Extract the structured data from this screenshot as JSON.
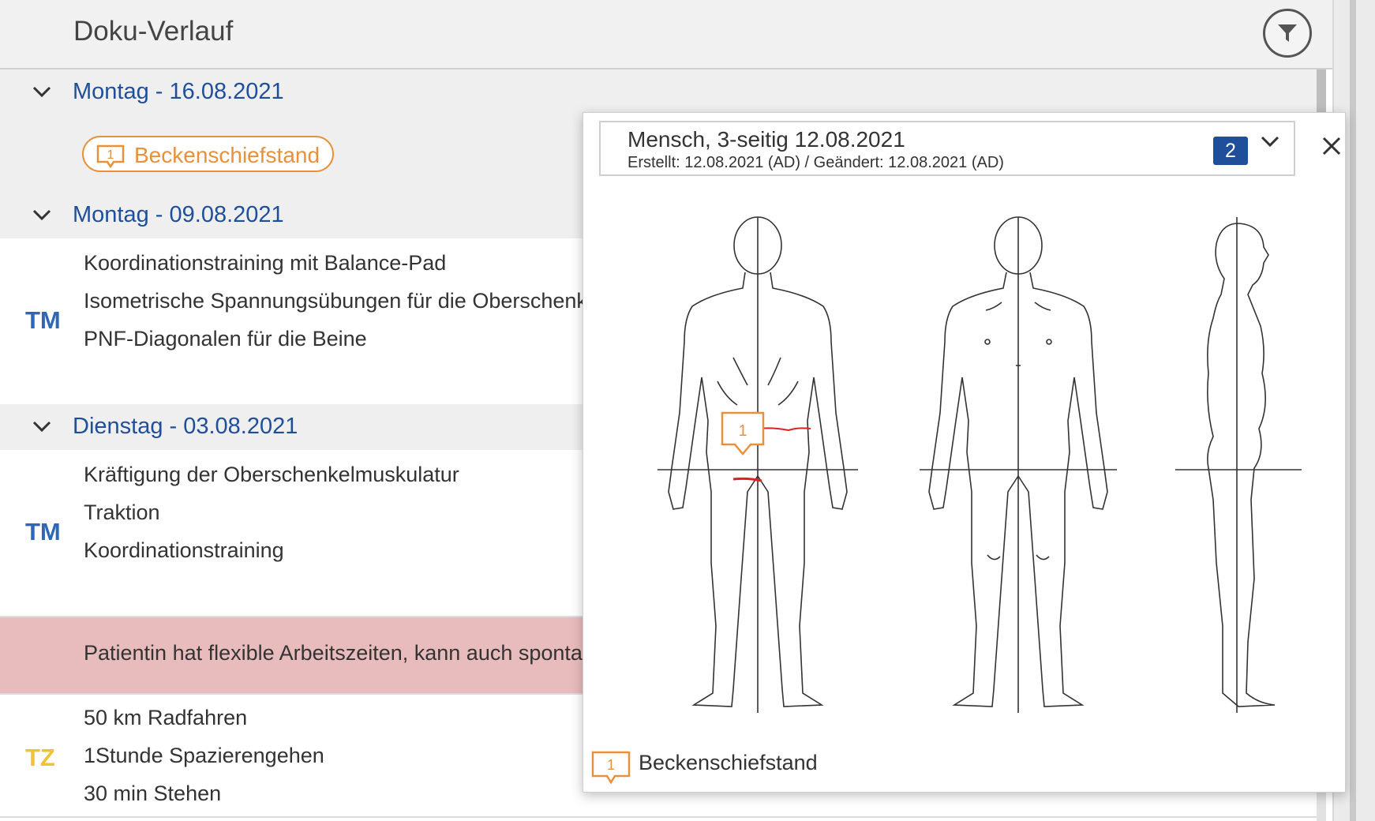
{
  "header": {
    "title": "Doku-Verlauf",
    "filter_icon": "filter-icon"
  },
  "days": [
    {
      "date": "Montag - 16.08.2021",
      "badge": {
        "number": "1",
        "label": "Beckenschiefstand"
      }
    },
    {
      "date": "Montag - 09.08.2021",
      "code": "TM",
      "entries": [
        "Koordinationstraining mit Balance-Pad",
        "Isometrische Spannungsübungen für die Oberschenkel",
        "PNF-Diagonalen für die Beine"
      ]
    },
    {
      "date": "Dienstag - 03.08.2021",
      "code": "TM",
      "entries": [
        "Kräftigung der Oberschenkelmuskulatur",
        "Traktion",
        "Koordinationstraining"
      ]
    }
  ],
  "note": "Patientin hat flexible Arbeitszeiten, kann auch spontan",
  "tz": {
    "code": "TZ",
    "entries": [
      "50 km Radfahren",
      "1Stunde Spazierengehen",
      "30 min Stehen"
    ]
  },
  "popup": {
    "title": "Mensch, 3-seitig 12.08.2021",
    "subtitle": "Erstellt: 12.08.2021 (AD) / Geändert: 12.08.2021 (AD)",
    "count": "2",
    "marker_number": "1",
    "legend": {
      "number": "1",
      "label": "Beckenschiefstand"
    }
  },
  "colors": {
    "accent_blue": "#1f4f9a",
    "marker_orange": "#e8913a",
    "note_red": "#e8bcbc",
    "tz_yellow": "#f1c232"
  }
}
